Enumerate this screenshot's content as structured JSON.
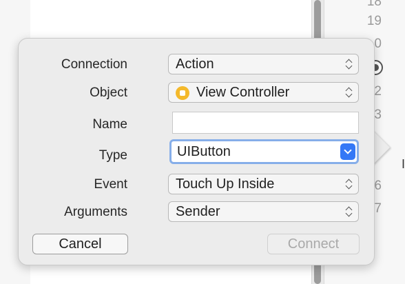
{
  "background": {
    "line_numbers": [
      "18",
      "19",
      "0",
      "2",
      "3",
      "6",
      "7"
    ]
  },
  "popover": {
    "fields": {
      "connection": {
        "label": "Connection",
        "value": "Action"
      },
      "object": {
        "label": "Object",
        "value": "View Controller",
        "icon": "view-controller-icon"
      },
      "name": {
        "label": "Name",
        "value": "",
        "placeholder": ""
      },
      "type": {
        "label": "Type",
        "value": "UIButton"
      },
      "event": {
        "label": "Event",
        "value": "Touch Up Inside"
      },
      "arguments": {
        "label": "Arguments",
        "value": "Sender"
      }
    },
    "buttons": {
      "cancel": "Cancel",
      "connect": "Connect"
    }
  },
  "colors": {
    "accent": "#3478f6",
    "focus_ring": "#86aee9",
    "object_icon": "#f4b92b"
  }
}
